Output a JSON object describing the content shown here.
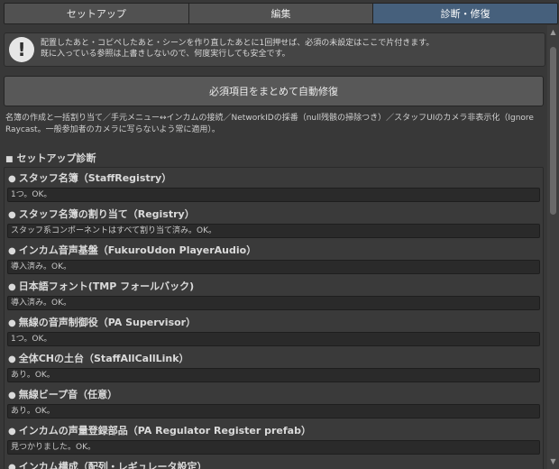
{
  "tabs": [
    {
      "label": "セットアップ",
      "active": false
    },
    {
      "label": "編集",
      "active": false
    },
    {
      "label": "診断・修復",
      "active": true
    }
  ],
  "notice": {
    "icon": "exclamation-icon",
    "line1": "配置したあと・コピペしたあと・シーンを作り直したあとに1回押せば、必須の未設定はここで片付きます。",
    "line2": "既に入っている参照は上書きしないので、何度実行しても安全です。"
  },
  "fix_button": {
    "label": "必須項目をまとめて自動修復"
  },
  "description": "名簿の作成と一括割り当て／手元メニュー↔インカムの接続／NetworkIDの採番（null残骸の掃除つき）／スタッフUIのカメラ非表示化（Ignore Raycast。一般参加者のカメラに写らないよう常に適用）。",
  "section": {
    "title": "セットアップ診断"
  },
  "checks": [
    {
      "title": "スタッフ名簿（StaffRegistry）",
      "status": "1つ。OK。"
    },
    {
      "title": "スタッフ名簿の割り当て（Registry）",
      "status": "スタッフ系コンポーネントはすべて割り当て済み。OK。"
    },
    {
      "title": "インカム音声基盤（FukuroUdon PlayerAudio）",
      "status": "導入済み。OK。"
    },
    {
      "title": "日本語フォント(TMP フォールバック)",
      "status": "導入済み。OK。"
    },
    {
      "title": "無線の音声制御役（PA Supervisor）",
      "status": "1つ。OK。"
    },
    {
      "title": "全体CHの土台（StaffAllCallLink）",
      "status": "あり。OK。"
    },
    {
      "title": "無線ビープ音（任意）",
      "status": "あり。OK。"
    },
    {
      "title": "インカムの声量登録部品（PA Regulator Register prefab）",
      "status": "見つかりました。OK。"
    },
    {
      "title": "インカム構成（配列・レギュレータ設定）",
      "status": ""
    }
  ],
  "colors": {
    "background": "#383838",
    "tab_active": "#46607c",
    "tab_inactive": "#515151",
    "button": "#585858",
    "status_field": "#2a2a2a"
  }
}
